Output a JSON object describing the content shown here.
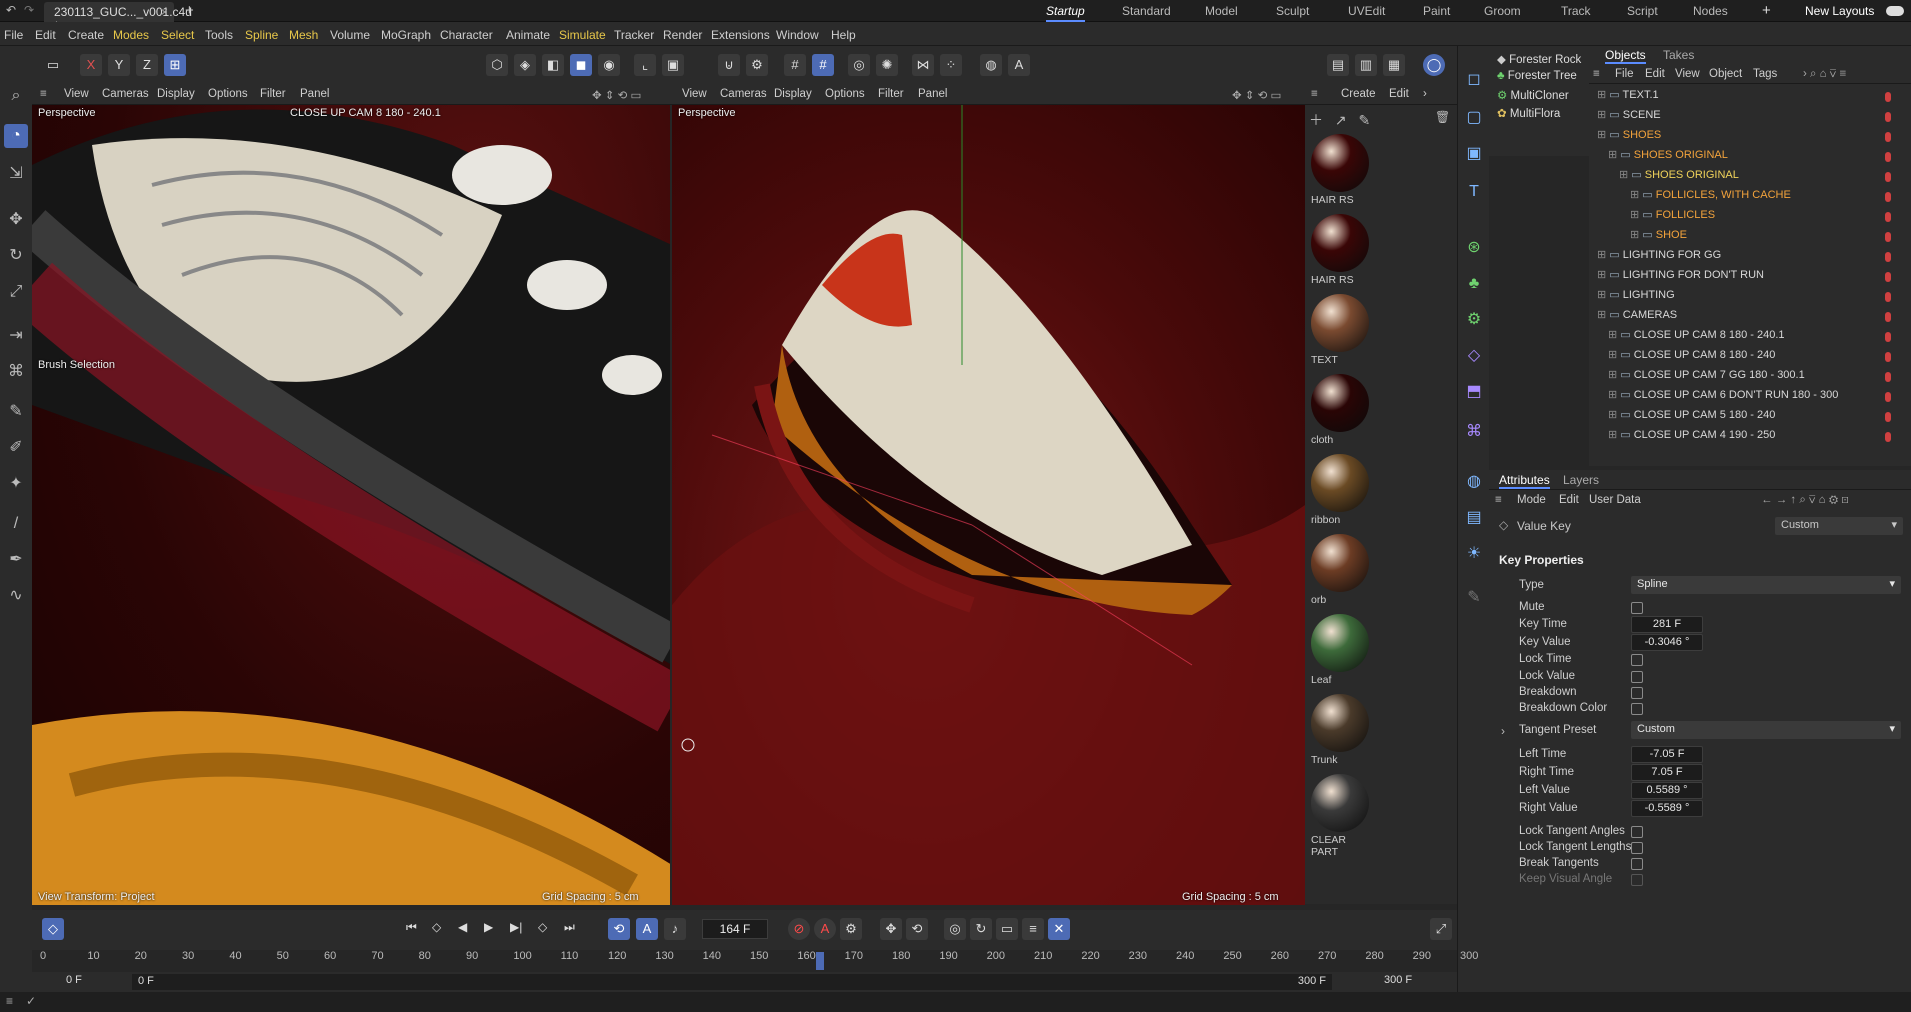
{
  "window": {
    "file_tab": "230113_GUC..._v001.c4d *",
    "layouts": [
      "Startup",
      "Standard",
      "Model",
      "Sculpt",
      "UVEdit",
      "Paint",
      "Groom",
      "Track",
      "Script",
      "Nodes"
    ],
    "active_layout": "Startup",
    "new_layouts": "New Layouts"
  },
  "menu": [
    "File",
    "Edit",
    "Create",
    "Modes",
    "Select",
    "Tools",
    "Spline",
    "Mesh",
    "Volume",
    "MoGraph",
    "Character",
    "Animate",
    "Simulate",
    "Tracker",
    "Render",
    "Extensions",
    "Window",
    "Help"
  ],
  "menu_highlight": [
    "Modes",
    "Select",
    "Spline",
    "Mesh",
    "Simulate"
  ],
  "toolbar": {
    "axes": [
      "X",
      "Y",
      "Z"
    ]
  },
  "viewport_left": {
    "menu": [
      "View",
      "Cameras",
      "Display",
      "Options",
      "Filter",
      "Panel"
    ],
    "label": "Perspective",
    "camera": "CLOSE UP CAM 8 180 - 240.1",
    "brush_label": "Brush Selection",
    "footer_left": "View Transform: Project",
    "grid_spacing": "Grid Spacing : 5 cm"
  },
  "viewport_right": {
    "menu": [
      "View",
      "Cameras",
      "Display",
      "Options",
      "Filter",
      "Panel"
    ],
    "label": "Perspective",
    "grid_spacing": "Grid Spacing : 5 cm"
  },
  "materials": {
    "menu": [
      "Create",
      "Edit"
    ],
    "items": [
      {
        "name": "HAIR RS",
        "color": "#3a0606"
      },
      {
        "name": "HAIR RS",
        "color": "#3a0606"
      },
      {
        "name": "TEXT",
        "color": "#7a4a30"
      },
      {
        "name": "cloth",
        "color": "#2a0505"
      },
      {
        "name": "ribbon",
        "color": "#6a4a24"
      },
      {
        "name": "orb",
        "color": "#6c3c24"
      },
      {
        "name": "Leaf",
        "color": "#3d6a3a"
      },
      {
        "name": "Trunk",
        "color": "#4a3a2a"
      },
      {
        "name": "CLEAR PART",
        "color": "#3a3a3a"
      }
    ]
  },
  "forester": [
    "Forester Rock",
    "Forester Tree",
    "MultiCloner",
    "MultiFlora"
  ],
  "objects": {
    "tabs": [
      "Objects",
      "Takes"
    ],
    "menu": [
      "File",
      "Edit",
      "View",
      "Object",
      "Tags"
    ],
    "items": [
      {
        "name": "TEXT.1",
        "indent": 0,
        "style": "normal"
      },
      {
        "name": "SCENE",
        "indent": 0,
        "style": "normal"
      },
      {
        "name": "SHOES",
        "indent": 0,
        "style": "orange"
      },
      {
        "name": "SHOES ORIGINAL",
        "indent": 1,
        "style": "orange"
      },
      {
        "name": "SHOES ORIGINAL",
        "indent": 2,
        "style": "yellow"
      },
      {
        "name": "FOLLICLES, WITH CACHE",
        "indent": 3,
        "style": "orange"
      },
      {
        "name": "FOLLICLES",
        "indent": 3,
        "style": "orange"
      },
      {
        "name": "SHOE",
        "indent": 3,
        "style": "orange"
      },
      {
        "name": "LIGHTING FOR GG",
        "indent": 0,
        "style": "normal"
      },
      {
        "name": "LIGHTING FOR DON'T RUN",
        "indent": 0,
        "style": "normal"
      },
      {
        "name": "LIGHTING",
        "indent": 0,
        "style": "normal"
      },
      {
        "name": "CAMERAS",
        "indent": 0,
        "style": "normal"
      },
      {
        "name": "CLOSE UP CAM 8 180 - 240.1",
        "indent": 1,
        "style": "normal"
      },
      {
        "name": "CLOSE UP CAM 8 180 - 240",
        "indent": 1,
        "style": "normal"
      },
      {
        "name": "CLOSE UP CAM 7 GG 180 - 300.1",
        "indent": 1,
        "style": "normal"
      },
      {
        "name": "CLOSE UP CAM 6 DON'T RUN 180 - 300",
        "indent": 1,
        "style": "normal"
      },
      {
        "name": "CLOSE UP CAM 5 180 - 240",
        "indent": 1,
        "style": "normal"
      },
      {
        "name": "CLOSE UP CAM 4 190 - 250",
        "indent": 1,
        "style": "normal"
      }
    ]
  },
  "attributes": {
    "tabs": [
      "Attributes",
      "Layers"
    ],
    "menu": [
      "Mode",
      "Edit",
      "User Data"
    ],
    "header": "Value Key",
    "header_preset": "Custom",
    "section": "Key Properties",
    "type_label": "Type",
    "type_value": "Spline",
    "mute": "Mute",
    "key_time_label": "Key Time",
    "key_time": "281 F",
    "key_value_label": "Key Value",
    "key_value": "-0.3046 °",
    "lock_time": "Lock Time",
    "lock_value": "Lock Value",
    "breakdown": "Breakdown",
    "breakdown_color": "Breakdown Color",
    "tangent_preset_label": "Tangent Preset",
    "tangent_preset": "Custom",
    "left_time_label": "Left Time",
    "left_time": "-7.05 F",
    "right_time_label": "Right Time",
    "right_time": "7.05 F",
    "left_value_label": "Left Value",
    "left_value": "0.5589 °",
    "right_value_label": "Right Value",
    "right_value": "-0.5589 °",
    "lock_tangent_angles": "Lock Tangent Angles",
    "lock_tangent_lengths": "Lock Tangent Lengths",
    "break_tangents": "Break Tangents",
    "keep_visual_angle": "Keep Visual Angle"
  },
  "timeline": {
    "current_frame": "164 F",
    "ticks": [
      "0",
      "10",
      "20",
      "30",
      "40",
      "50",
      "60",
      "70",
      "80",
      "90",
      "100",
      "110",
      "120",
      "130",
      "140",
      "150",
      "160",
      "170",
      "180",
      "190",
      "200",
      "210",
      "220",
      "230",
      "240",
      "250",
      "260",
      "270",
      "280",
      "290",
      "300"
    ],
    "playhead": 164,
    "start": "0 F",
    "start2": "0 F",
    "end": "300 F",
    "end2": "300 F"
  }
}
